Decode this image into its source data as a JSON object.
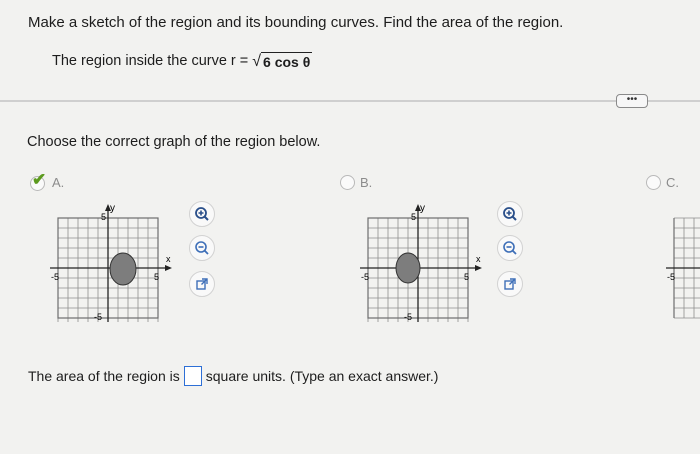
{
  "question": {
    "title": "Make a sketch of the region and its bounding curves. Find the area of the region.",
    "region_prefix": "The region inside the curve r =",
    "region_expr": "6 cos θ"
  },
  "more_button": "•••",
  "choose_text": "Choose the correct graph of the region below.",
  "options": [
    {
      "label": "A.",
      "selected": true
    },
    {
      "label": "B.",
      "selected": false
    },
    {
      "label": "C.",
      "selected": false
    }
  ],
  "graph": {
    "y_axis_label": "y",
    "x_axis_label": "x",
    "tick_pos": "5",
    "tick_neg": "-5"
  },
  "answer": {
    "prefix": "The area of the region is",
    "value": "",
    "suffix": "square units. (Type an exact answer.)"
  },
  "colors": {
    "background": "#f2f2f0",
    "selected_check": "#5c9a1f",
    "answer_box_border": "#2d6fd6",
    "region_fill": "#7d7d7d"
  }
}
